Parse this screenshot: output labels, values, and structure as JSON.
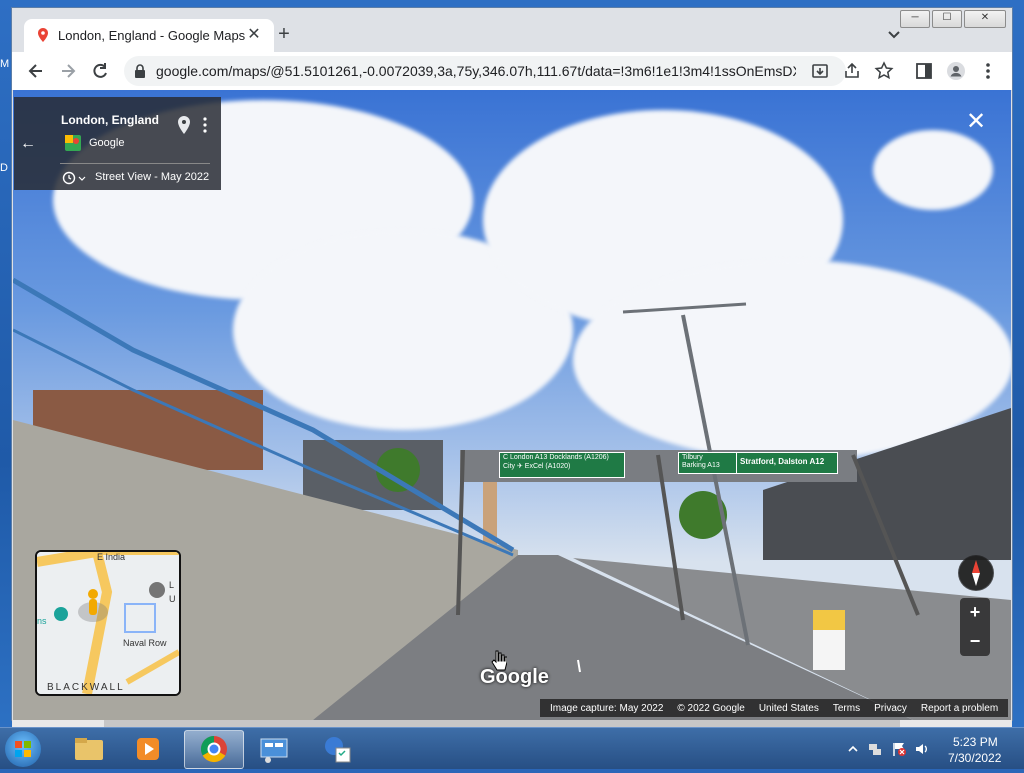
{
  "desktop": {
    "glyph_top": "M",
    "glyph_mid": "D"
  },
  "browser": {
    "tab_title": "London, England - Google Maps",
    "url": "google.com/maps/@51.5101261,-0.0072039,3a,75y,346.07h,111.67t/data=!3m6!1e1!3m4!1ssOnEmsDX...",
    "new_tab_label": "+",
    "tab_close_label": "✕",
    "window_buttons": [
      "─",
      "☐",
      "✕"
    ]
  },
  "streetview": {
    "title": "London, England",
    "provider": "Google",
    "date_label": "Street View - May 2022",
    "back_label": "←",
    "close_label": "✕",
    "zoom_in": "+",
    "zoom_out": "−",
    "logo": "Google",
    "signs": {
      "left_line1": "C London A13  Docklands (A1206)",
      "left_line2": "City  ✈ ExCel (A1020)",
      "right_line1": "Tilbury",
      "right_line2": "Barking A13",
      "right_line3": "Stratford, Dalston A12"
    },
    "minimap_labels": [
      "E India",
      "Naval Row",
      "BLACKWALL",
      "L",
      "U",
      "ns"
    ],
    "footer": [
      "Image capture: May 2022",
      "© 2022 Google",
      "United States",
      "Terms",
      "Privacy",
      "Report a problem"
    ]
  },
  "taskbar": {
    "time": "5:23 PM",
    "date": "7/30/2022"
  },
  "colors": {
    "accent": "#1a73e8",
    "sign_green": "#1f7a45"
  }
}
